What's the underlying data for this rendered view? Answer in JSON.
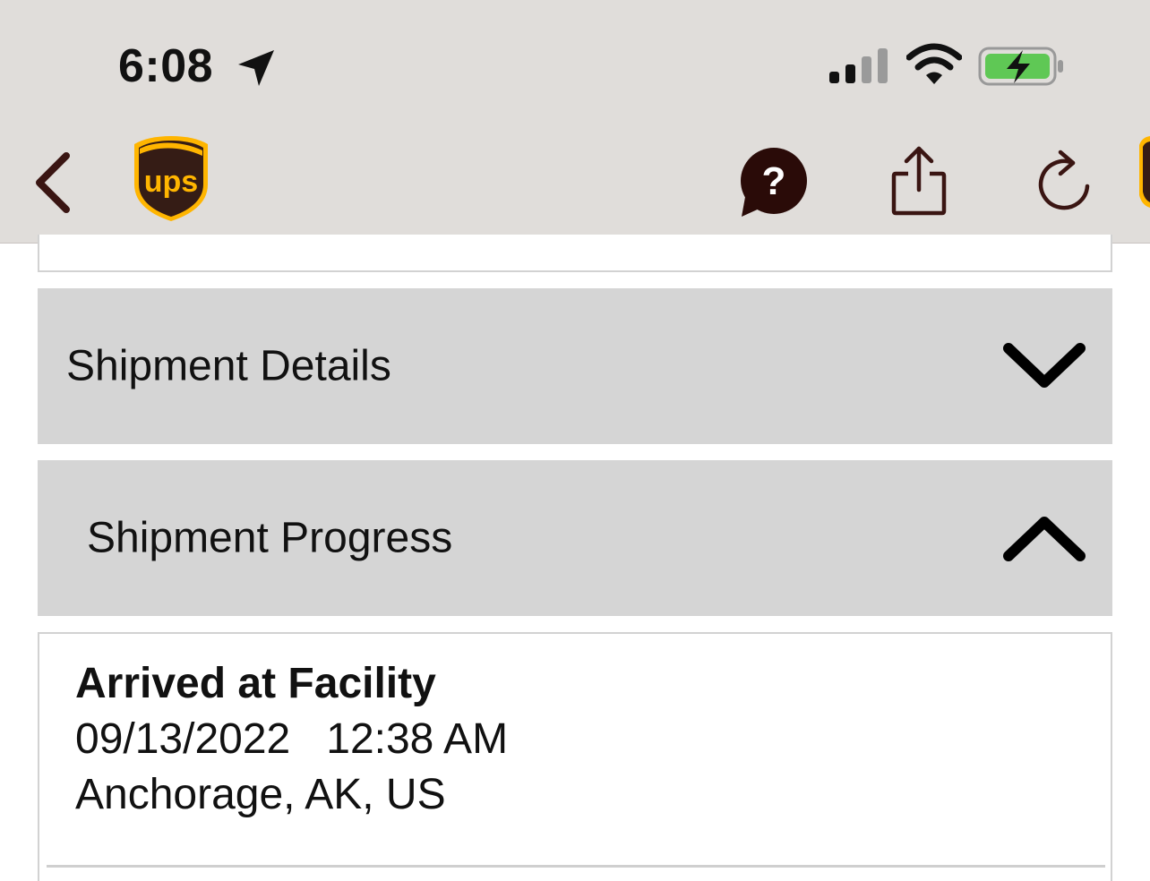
{
  "status_bar": {
    "time": "6:08",
    "icons": [
      "location-arrow-icon",
      "signal-icon",
      "wifi-icon",
      "battery-charging-icon"
    ]
  },
  "nav": {
    "icons": [
      "back-chevron-icon",
      "ups-logo",
      "help-icon",
      "share-icon",
      "reload-icon"
    ],
    "logo_text": "ups"
  },
  "colors": {
    "ups_brown": "#351c15",
    "ups_gold": "#ffb500",
    "header_bg": "#e0ddda",
    "accordion_bg": "#d5d5d5",
    "battery_green": "#5fc855"
  },
  "sections": {
    "details": {
      "label": "Shipment Details",
      "state": "collapsed"
    },
    "progress": {
      "label": "Shipment Progress",
      "state": "expanded"
    }
  },
  "progress_events": [
    {
      "status": "Arrived at Facility",
      "datetime": "09/13/2022   12:38 AM",
      "location": "Anchorage, AK, US"
    }
  ]
}
